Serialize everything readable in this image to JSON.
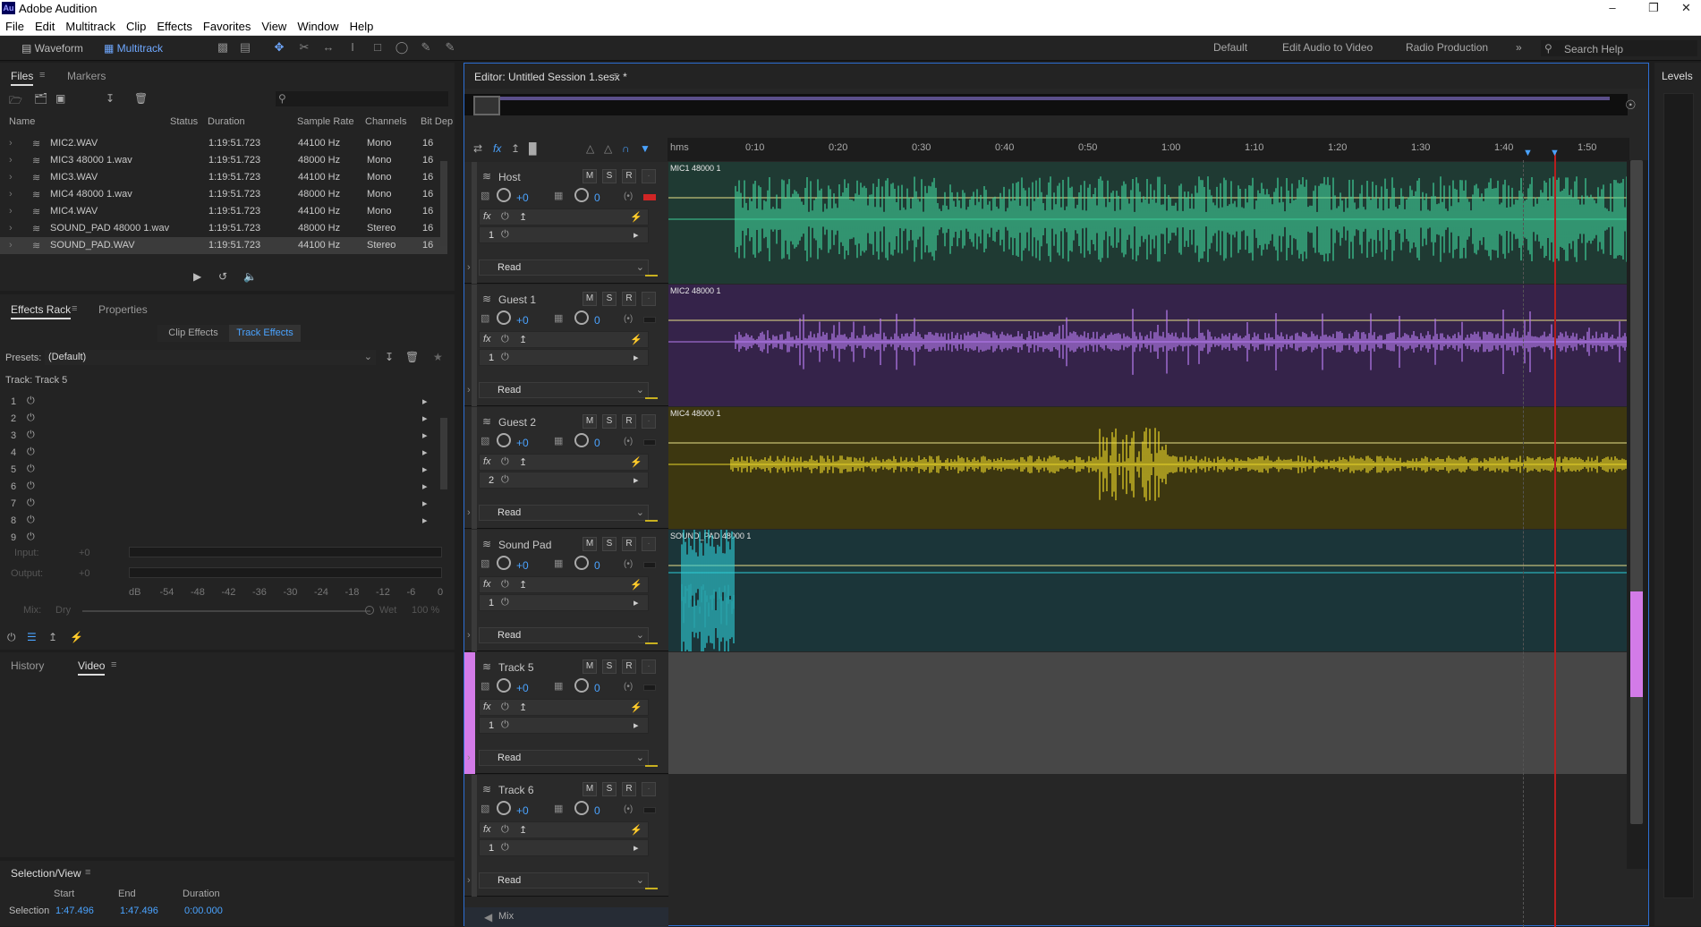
{
  "app": {
    "title": "Adobe Audition",
    "logo": "Au"
  },
  "menu": [
    "File",
    "Edit",
    "Multitrack",
    "Clip",
    "Effects",
    "Favorites",
    "View",
    "Window",
    "Help"
  ],
  "toolbar": {
    "waveform_label": "Waveform",
    "multitrack_label": "Multitrack",
    "workspaces": [
      "Default",
      "Edit Audio to Video",
      "Radio Production"
    ],
    "search_placeholder": "Search Help"
  },
  "files": {
    "tabs": [
      "Files",
      "Markers"
    ],
    "columns": [
      "Name",
      "Status",
      "Duration",
      "Sample Rate",
      "Channels",
      "Bit Dep"
    ],
    "rows": [
      {
        "name": "MIC2.WAV",
        "duration": "1:19:51.723",
        "rate": "44100 Hz",
        "channels": "Mono",
        "bits": "16"
      },
      {
        "name": "MIC3 48000 1.wav",
        "duration": "1:19:51.723",
        "rate": "48000 Hz",
        "channels": "Mono",
        "bits": "16"
      },
      {
        "name": "MIC3.WAV",
        "duration": "1:19:51.723",
        "rate": "44100 Hz",
        "channels": "Mono",
        "bits": "16"
      },
      {
        "name": "MIC4 48000 1.wav",
        "duration": "1:19:51.723",
        "rate": "48000 Hz",
        "channels": "Mono",
        "bits": "16"
      },
      {
        "name": "MIC4.WAV",
        "duration": "1:19:51.723",
        "rate": "44100 Hz",
        "channels": "Mono",
        "bits": "16"
      },
      {
        "name": "SOUND_PAD 48000 1.wav",
        "duration": "1:19:51.723",
        "rate": "48000 Hz",
        "channels": "Stereo",
        "bits": "16"
      },
      {
        "name": "SOUND_PAD.WAV",
        "duration": "1:19:51.723",
        "rate": "44100 Hz",
        "channels": "Stereo",
        "bits": "16"
      }
    ]
  },
  "effects": {
    "tabs": [
      "Effects Rack",
      "Properties"
    ],
    "subtabs": [
      "Clip Effects",
      "Track Effects"
    ],
    "presets_label": "Presets:",
    "preset_value": "(Default)",
    "track_label": "Track: Track 5",
    "slots": [
      "1",
      "2",
      "3",
      "4",
      "5",
      "6",
      "7",
      "8",
      "9"
    ],
    "input_label": "Input:",
    "output_label": "Output:",
    "io_value": "+0",
    "scale": [
      "dB",
      "-54",
      "-48",
      "-42",
      "-36",
      "-30",
      "-24",
      "-18",
      "-12",
      "-6",
      "0"
    ],
    "mix_label": "Mix:",
    "dry_label": "Dry",
    "wet_label": "Wet",
    "wet_value": "100 %"
  },
  "history": {
    "tabs": [
      "History",
      "Video"
    ]
  },
  "selection": {
    "title": "Selection/View",
    "columns": [
      "Start",
      "End",
      "Duration"
    ],
    "row_label": "Selection",
    "start": "1:47.496",
    "end": "1:47.496",
    "duration": "0:00.000"
  },
  "editor": {
    "title": "Editor: Untitled Session 1.sesx *",
    "ruler_unit": "hms",
    "ruler": [
      "0:10",
      "0:20",
      "0:30",
      "0:40",
      "0:50",
      "1:00",
      "1:10",
      "1:20",
      "1:30",
      "1:40",
      "1:50"
    ],
    "read_label": "Read",
    "mix_label": "Mix",
    "tracks": [
      {
        "name": "Host",
        "vol": "+0",
        "pan": "0",
        "clip": "MIC1 48000 1",
        "color": "#1f3a33",
        "wave": "#3fcf9a"
      },
      {
        "name": "Guest 1",
        "vol": "+0",
        "pan": "0",
        "clip": "MIC2 48000 1",
        "color": "#35234a",
        "wave": "#b77cf0"
      },
      {
        "name": "Guest 2",
        "vol": "+0",
        "pan": "0",
        "clip": "MIC4 48000 1",
        "color": "#3d3710",
        "wave": "#e8d42a"
      },
      {
        "name": "Sound Pad",
        "vol": "+0",
        "pan": "0",
        "clip": "SOUND_PAD 48000 1",
        "color": "#1b3539",
        "wave": "#2ecdd6"
      },
      {
        "name": "Track 5",
        "vol": "+0",
        "pan": "0",
        "clip": "",
        "color": "#474747",
        "wave": ""
      },
      {
        "name": "Track 6",
        "vol": "+0",
        "pan": "0",
        "clip": "",
        "color": "#262626",
        "wave": ""
      }
    ]
  },
  "levels": {
    "title": "Levels"
  }
}
